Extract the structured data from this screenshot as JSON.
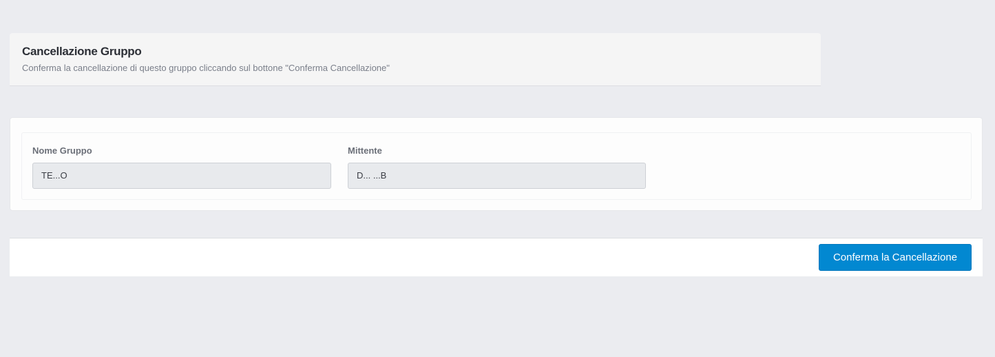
{
  "header": {
    "title": "Cancellazione Gruppo",
    "subtitle": "Conferma la cancellazione di questo gruppo cliccando sul bottone \"Conferma Cancellazione\""
  },
  "form": {
    "group_name": {
      "label": "Nome Gruppo",
      "value": "TE...O"
    },
    "sender": {
      "label": "Mittente",
      "value": "D... ...B"
    }
  },
  "footer": {
    "confirm_label": "Conferma la Cancellazione"
  },
  "colors": {
    "background": "#ebecf0",
    "accent": "#0288d1"
  }
}
